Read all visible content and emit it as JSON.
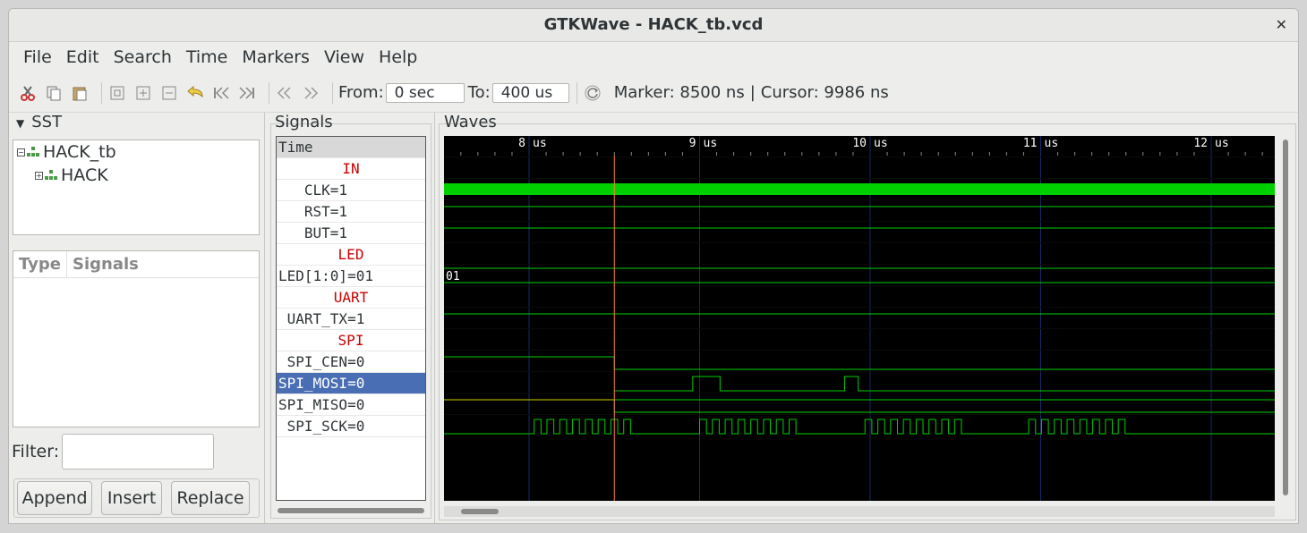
{
  "window": {
    "title": "GTKWave - HACK_tb.vcd",
    "close_glyph": "✕"
  },
  "menu": [
    "File",
    "Edit",
    "Search",
    "Time",
    "Markers",
    "View",
    "Help"
  ],
  "toolbar": {
    "from_label": "From:",
    "from_value": "0 sec",
    "to_label": "To:",
    "to_value": "400 us",
    "marker_text": "Marker: 8500 ns",
    "separator": "|",
    "cursor_text": "Cursor: 9986 ns",
    "icons": [
      "cut-icon",
      "copy-icon",
      "paste-icon",
      "zoom-fit-icon",
      "zoom-in-icon",
      "zoom-out-icon",
      "undo-zoom-icon",
      "zoom-start-icon",
      "zoom-end-icon",
      "page-back-icon",
      "page-forward-icon",
      "reload-icon"
    ]
  },
  "sst": {
    "header": "SST",
    "tree": [
      {
        "label": "HACK_tb"
      },
      {
        "label": "HACK"
      }
    ],
    "list_columns": [
      "Type",
      "Signals"
    ],
    "filter_label": "Filter:",
    "filter_value": "",
    "buttons": [
      "Append",
      "Insert",
      "Replace"
    ]
  },
  "signals_panel": {
    "title": "Signals",
    "rows": [
      {
        "text": "Time",
        "kind": "head"
      },
      {
        "text": "IN",
        "kind": "group"
      },
      {
        "text": "   CLK=1",
        "kind": "signal"
      },
      {
        "text": "   RST=1",
        "kind": "signal"
      },
      {
        "text": "   BUT=1",
        "kind": "signal"
      },
      {
        "text": "LED",
        "kind": "group"
      },
      {
        "text": "LED[1:0]=01",
        "kind": "signal"
      },
      {
        "text": "UART",
        "kind": "group"
      },
      {
        "text": " UART_TX=1",
        "kind": "signal"
      },
      {
        "text": "SPI",
        "kind": "group"
      },
      {
        "text": " SPI_CEN=0",
        "kind": "signal"
      },
      {
        "text": "SPI_MOSI=0",
        "kind": "selected"
      },
      {
        "text": "SPI_MISO=0",
        "kind": "signal"
      },
      {
        "text": " SPI_SCK=0",
        "kind": "signal"
      }
    ]
  },
  "waves": {
    "title": "Waves",
    "time_axis": [
      "8 us",
      "9 us",
      "10 us",
      "11 us",
      "12 us"
    ],
    "led_value_label": "01",
    "marker_ns": 8500,
    "colors": {
      "background": "#000000",
      "trace": "#00d000",
      "clock_fill": "#00d000",
      "grid": "#1a2a6a",
      "marker": "#ff8040",
      "undefined": "#d0d000"
    }
  }
}
